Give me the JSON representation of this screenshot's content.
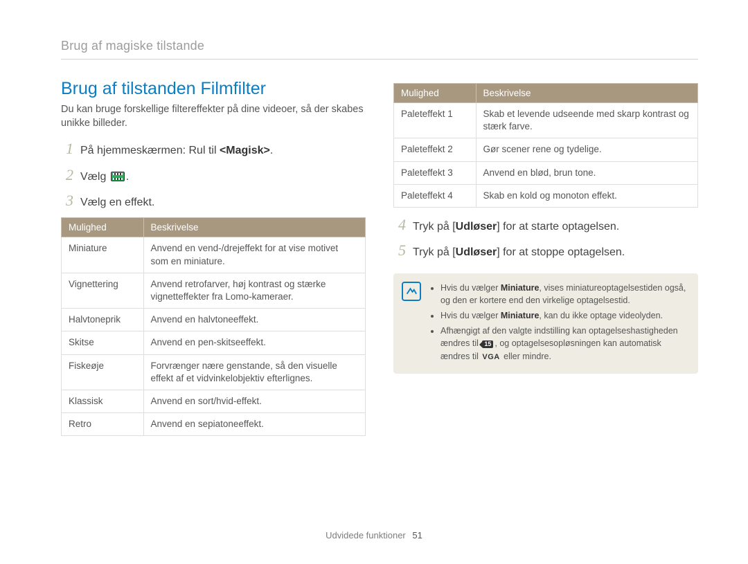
{
  "breadcrumb": "Brug af magiske tilstande",
  "heading": "Brug af tilstanden Filmfilter",
  "intro": "Du kan bruge forskellige filtereffekter på dine videoer, så der skabes unikke billeder.",
  "steps_left": [
    {
      "num": "1",
      "pre": "På hjemmeskærmen: Rul til ",
      "bold": "<Magisk>",
      "post": "."
    },
    {
      "num": "2",
      "pre": "Vælg ",
      "icon": "film",
      "post": "."
    },
    {
      "num": "3",
      "pre": "Vælg en effekt."
    }
  ],
  "table_headers": {
    "option": "Mulighed",
    "desc": "Beskrivelse"
  },
  "table_left": [
    {
      "option": "Miniature",
      "desc": "Anvend en vend-/drejeffekt for at vise motivet som en miniature."
    },
    {
      "option": "Vignettering",
      "desc": "Anvend retrofarver, høj kontrast og stærke vignetteffekter fra Lomo-kameraer."
    },
    {
      "option": "Halvtoneprik",
      "desc": "Anvend en halvtoneeffekt."
    },
    {
      "option": "Skitse",
      "desc": "Anvend en pen-skitseeffekt."
    },
    {
      "option": "Fiskeøje",
      "desc": "Forvrænger nære genstande, så den visuelle effekt af et vidvinkelobjektiv efterlignes."
    },
    {
      "option": "Klassisk",
      "desc": "Anvend en sort/hvid-effekt."
    },
    {
      "option": "Retro",
      "desc": "Anvend en sepiatoneeffekt."
    }
  ],
  "table_right": [
    {
      "option": "Paleteffekt 1",
      "desc": "Skab et levende udseende med skarp kontrast og stærk farve."
    },
    {
      "option": "Paleteffekt 2",
      "desc": "Gør scener rene og tydelige."
    },
    {
      "option": "Paleteffekt 3",
      "desc": "Anvend en blød, brun tone."
    },
    {
      "option": "Paleteffekt 4",
      "desc": "Skab en kold og monoton effekt."
    }
  ],
  "steps_right": [
    {
      "num": "4",
      "pre": "Tryk på [",
      "bold": "Udløser",
      "post": "] for at starte optagelsen."
    },
    {
      "num": "5",
      "pre": "Tryk på [",
      "bold": "Udløser",
      "post": "] for at stoppe optagelsen."
    }
  ],
  "notes": {
    "n1_a": "Hvis du vælger ",
    "n1_bold": "Miniature",
    "n1_b": ", vises miniatureoptagelsestiden også, og den er kortere end den virkelige optagelsestid.",
    "n2_a": "Hvis du vælger ",
    "n2_bold": "Miniature",
    "n2_b": ", kan du ikke optage videolyden.",
    "n3_a": "Afhængigt af den valgte indstilling kan optagelseshastigheden ændres til ",
    "n3_b": ", og optagelsesopløsningen kan automatisk ændres til ",
    "n3_c": " eller mindre.",
    "fps_label": "15",
    "vga_label": "VGA"
  },
  "footer": {
    "section": "Udvidede funktioner",
    "page": "51"
  }
}
